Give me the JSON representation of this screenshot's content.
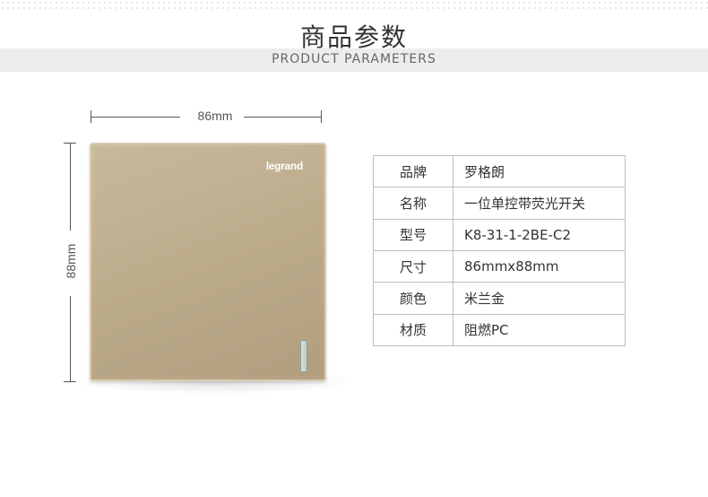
{
  "header": {
    "title": "商品参数",
    "subtitle": "PRODUCT PARAMETERS"
  },
  "dimensions": {
    "width_label": "86mm",
    "height_label": "88mm"
  },
  "product": {
    "brand_logo": "legrand",
    "finish_color": "#bfae8e"
  },
  "specs": [
    {
      "label": "品牌",
      "value": "罗格朗"
    },
    {
      "label": "名称",
      "value": "一位单控带荧光开关"
    },
    {
      "label": "型号",
      "value": "K8-31-1-2BE-C2"
    },
    {
      "label": "尺寸",
      "value": "86mmx88mm"
    },
    {
      "label": "颜色",
      "value": "米兰金"
    },
    {
      "label": "材质",
      "value": "阻燃PC"
    }
  ]
}
